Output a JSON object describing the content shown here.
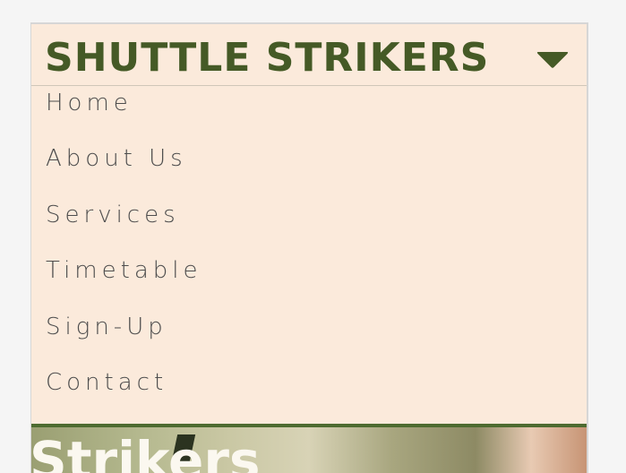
{
  "header": {
    "brand": "SHUTTLE STRIKERS",
    "toggle_icon": "caret-down-icon",
    "brand_color": "#455a26"
  },
  "nav": {
    "items": [
      {
        "label": "Home"
      },
      {
        "label": "About Us"
      },
      {
        "label": "Services"
      },
      {
        "label": "Timetable"
      },
      {
        "label": "Sign-Up"
      },
      {
        "label": "Contact"
      }
    ]
  },
  "hero": {
    "title": "Strikers"
  },
  "colors": {
    "background": "#fbeadb",
    "accent": "#4d6b30",
    "text": "#4d4d4d"
  }
}
